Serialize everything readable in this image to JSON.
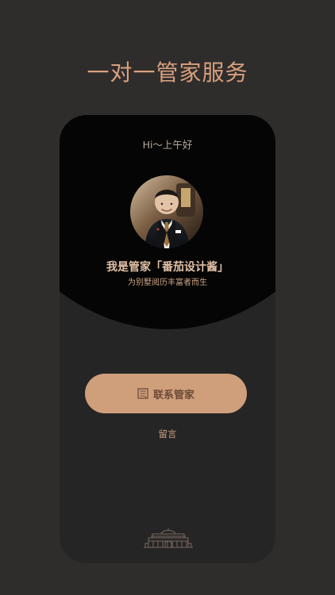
{
  "page": {
    "title": "一对一管家服务"
  },
  "card": {
    "greeting": "Hi～上午好",
    "intro": "我是管家「番茄设计酱」",
    "subtitle": "为别墅阅历丰富者而生",
    "contact_button": "联系管家",
    "message_link": "留言"
  },
  "icons": {
    "contact": "contact-card-icon",
    "logo": "mansion-building-icon"
  },
  "colors": {
    "background": "#2f2d2c",
    "accent": "#d9a07e",
    "button": "#cf9f7c",
    "panel": "#050505"
  }
}
